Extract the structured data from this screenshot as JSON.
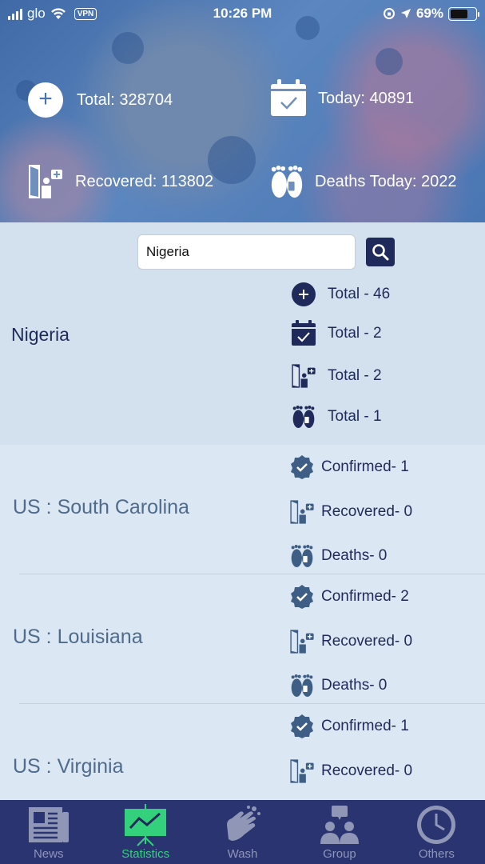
{
  "status_bar": {
    "carrier": "glo",
    "vpn": "VPN",
    "time": "10:26 PM",
    "battery_percent": "69%"
  },
  "summary": {
    "total": "Total: 328704",
    "today": "Today: 40891",
    "recovered": "Recovered: 113802",
    "deaths_today": "Deaths Today: 2022"
  },
  "search": {
    "value": "Nigeria"
  },
  "nigeria": {
    "name": "Nigeria",
    "metrics": [
      "Total - 46",
      "Total - 2",
      "Total - 2",
      "Total - 1"
    ]
  },
  "us_rows": [
    {
      "name": "US : South Carolina",
      "confirmed": "Confirmed- 1",
      "recovered": "Recovered- 0",
      "deaths": "Deaths- 0"
    },
    {
      "name": "US : Louisiana",
      "confirmed": "Confirmed- 2",
      "recovered": "Recovered- 0",
      "deaths": "Deaths- 0"
    },
    {
      "name": "US : Virginia",
      "confirmed": "Confirmed- 1",
      "recovered": "Recovered- 0"
    }
  ],
  "tabs": [
    "News",
    "Statistics",
    "Wash",
    "Group",
    "Others"
  ],
  "colors": {
    "navy": "#1f2a5a",
    "tabbar": "#2a3470",
    "active_tab": "#34d17d",
    "badge": "#3f5e86"
  }
}
